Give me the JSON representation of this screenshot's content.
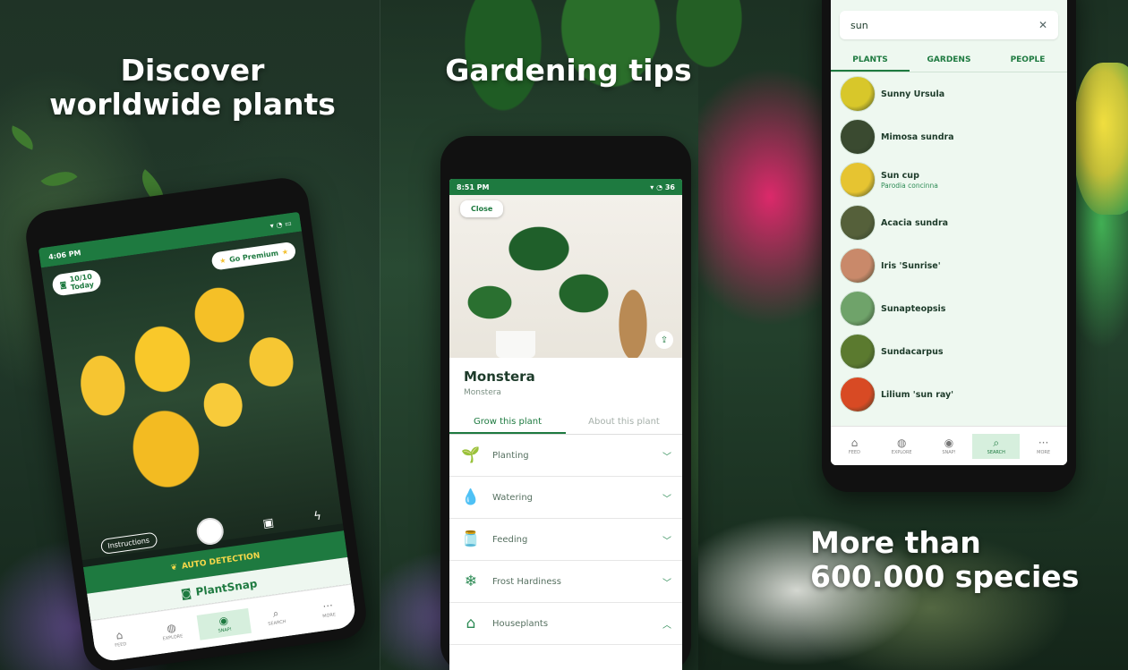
{
  "headlines": {
    "left_line1": "Discover",
    "left_line2": "worldwide plants",
    "middle": "Gardening tips",
    "right_line1": "More than",
    "right_line2": "600.000 species"
  },
  "camera_screen": {
    "status_time": "4:06 PM",
    "counter_line1": "10/10",
    "counter_line2": "Today",
    "premium_label": "Go Premium",
    "instructions_label": "Instructions",
    "auto_detection_label": "AUTO DETECTION",
    "brand_label": "PlantSnap",
    "accent_color": "#1e7a40"
  },
  "plant_screen": {
    "status_time": "8:51 PM",
    "battery": "36",
    "close_label": "Close",
    "plant_name": "Monstera",
    "plant_scientific": "Monstera",
    "tabs": [
      "Grow this plant",
      "About this plant"
    ],
    "rows": [
      {
        "label": "Planting",
        "icon": "planting-icon",
        "glyph": "🌱",
        "expanded": false
      },
      {
        "label": "Watering",
        "icon": "watering-icon",
        "glyph": "💧",
        "expanded": false
      },
      {
        "label": "Feeding",
        "icon": "feeding-icon",
        "glyph": "🫙",
        "expanded": false
      },
      {
        "label": "Frost Hardiness",
        "icon": "frost-icon",
        "glyph": "❄",
        "expanded": false
      },
      {
        "label": "Houseplants",
        "icon": "house-icon",
        "glyph": "⌂",
        "expanded": true
      }
    ]
  },
  "search_screen": {
    "query": "sun",
    "tabs": [
      "PLANTS",
      "GARDENS",
      "PEOPLE"
    ],
    "results": [
      {
        "name": "Sunny Ursula",
        "scientific": "",
        "color": "#d8c72a"
      },
      {
        "name": "Mimosa sundra",
        "scientific": "",
        "color": "#3a4a30"
      },
      {
        "name": "Sun cup",
        "scientific": "Parodia concinna",
        "color": "#e6c431"
      },
      {
        "name": "Acacia sundra",
        "scientific": "",
        "color": "#55603a"
      },
      {
        "name": "Iris 'Sunrise'",
        "scientific": "",
        "color": "#c9896a"
      },
      {
        "name": "Sunapteopsis",
        "scientific": "",
        "color": "#6fa36a"
      },
      {
        "name": "Sundacarpus",
        "scientific": "",
        "color": "#5b7a2f"
      },
      {
        "name": "Lilium 'sun ray'",
        "scientific": "",
        "color": "#d84a24"
      }
    ]
  },
  "nav": {
    "items": [
      {
        "label": "FEED",
        "icon": "home-icon",
        "glyph": "⌂"
      },
      {
        "label": "EXPLORE",
        "icon": "globe-icon",
        "glyph": "◍"
      },
      {
        "label": "SNAP!",
        "icon": "camera-icon",
        "glyph": "◉"
      },
      {
        "label": "SEARCH",
        "icon": "search-icon",
        "glyph": "⌕"
      },
      {
        "label": "MORE",
        "icon": "more-icon",
        "glyph": "···"
      }
    ]
  }
}
